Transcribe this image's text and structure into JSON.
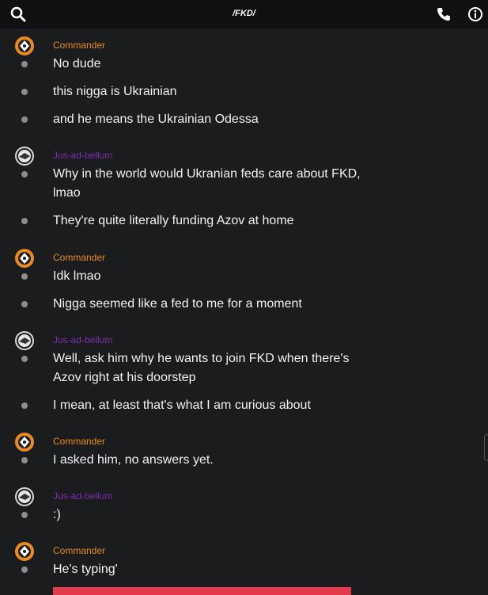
{
  "header": {
    "title": "/FKD/",
    "search_icon": "search-icon",
    "call_icon": "phone-icon",
    "info_icon": "info-icon"
  },
  "colors": {
    "commander": "#e98a26",
    "jus_ad_bellum": "#7a2fb0",
    "background": "#1b1c1e",
    "topbar": "#0f1011",
    "typing_bar": "#e23a4a"
  },
  "groups": [
    {
      "author": "Commander",
      "messages": [
        "No dude",
        "this nigga is Ukrainian",
        "and he means the Ukrainian Odessa"
      ]
    },
    {
      "author": "Jus-ad-bellum",
      "messages": [
        "Why in the world would Ukranian feds care about FKD, lmao",
        "They're quite literally funding Azov at home"
      ]
    },
    {
      "author": "Commander",
      "messages": [
        "Idk lmao",
        "Nigga seemed like a fed to me for a moment"
      ]
    },
    {
      "author": "Jus-ad-bellum",
      "messages": [
        "Well, ask him why he wants to join FKD when there's Azov right at his doorstep",
        "I mean, at least that's what I am curious about"
      ]
    },
    {
      "author": "Commander",
      "messages": [
        "I asked him, no answers yet."
      ]
    },
    {
      "author": "Jus-ad-bellum",
      "messages": [
        ":)"
      ]
    },
    {
      "author": "Commander",
      "messages": [
        "He's typing'"
      ]
    }
  ]
}
